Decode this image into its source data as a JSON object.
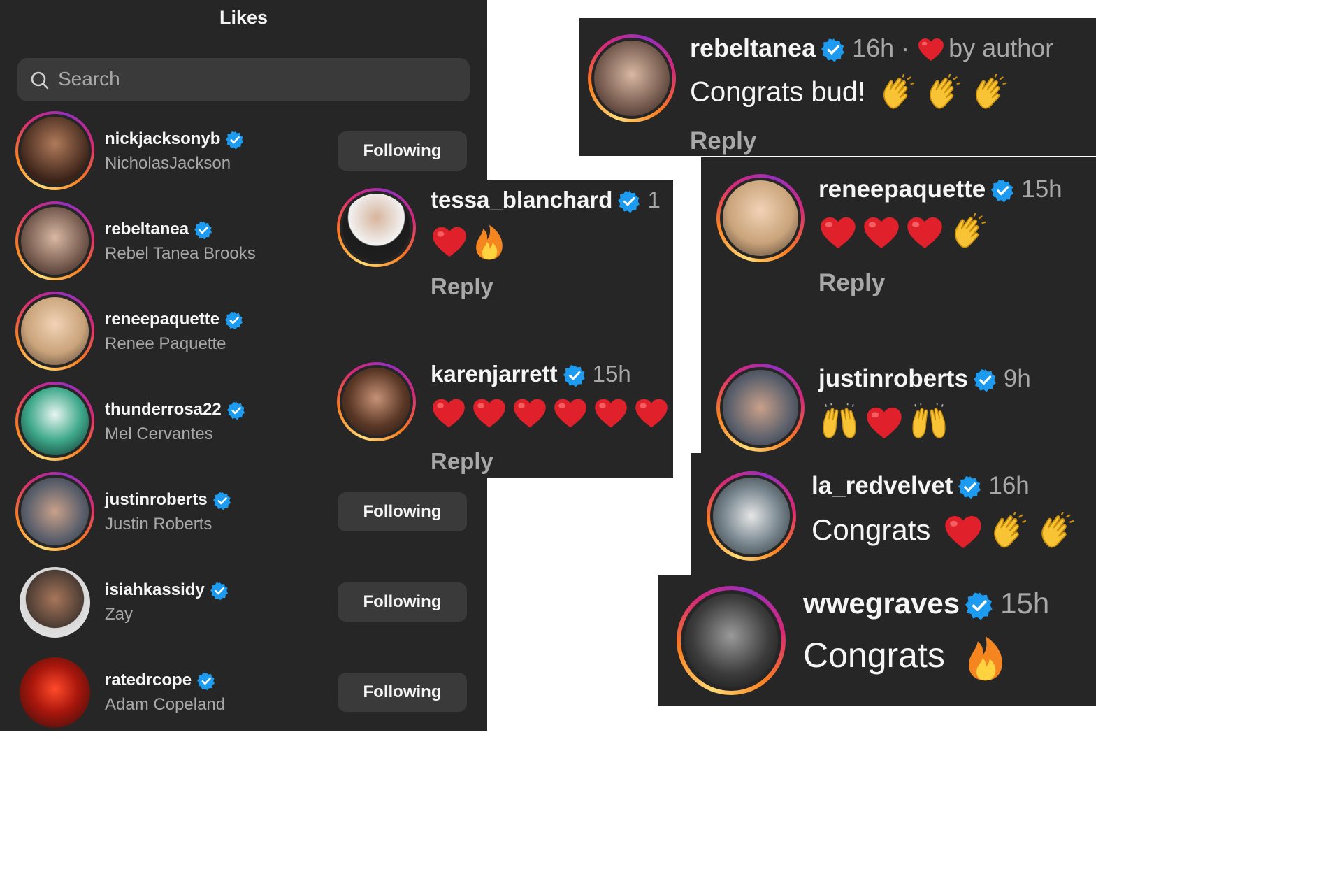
{
  "likes": {
    "title": "Likes",
    "search_placeholder": "Search",
    "following_label": "Following",
    "users": [
      {
        "username": "nickjacksonyb",
        "name": "NicholasJackson"
      },
      {
        "username": "rebeltanea",
        "name": "Rebel Tanea Brooks"
      },
      {
        "username": "reneepaquette",
        "name": "Renee Paquette"
      },
      {
        "username": "thunderrosa22",
        "name": "Mel Cervantes"
      },
      {
        "username": "justinroberts",
        "name": "Justin Roberts"
      },
      {
        "username": "isiahkassidy",
        "name": "Zay"
      },
      {
        "username": "ratedrcope",
        "name": "Adam Copeland"
      }
    ]
  },
  "comments": {
    "reply_label": "Reply",
    "rebeltanea": {
      "username": "rebeltanea",
      "time": "16h ·",
      "liked_by": "by author",
      "text": "Congrats bud!"
    },
    "tessa": {
      "username": "tessa_blanchard",
      "time": "1"
    },
    "karen": {
      "username": "karenjarrett",
      "time": "15h"
    },
    "renee": {
      "username": "reneepaquette",
      "time": "15h"
    },
    "justin": {
      "username": "justinroberts",
      "time": "9h"
    },
    "redvelvet": {
      "username": "la_redvelvet",
      "time": "16h",
      "text": "Congrats"
    },
    "graves": {
      "username": "wwegraves",
      "time": "15h",
      "text": "Congrats"
    }
  },
  "colors": {
    "background": "#262626",
    "verified": "#1d9bf0",
    "heart": "#e0202a",
    "secondary_text": "#a8a8a8"
  }
}
